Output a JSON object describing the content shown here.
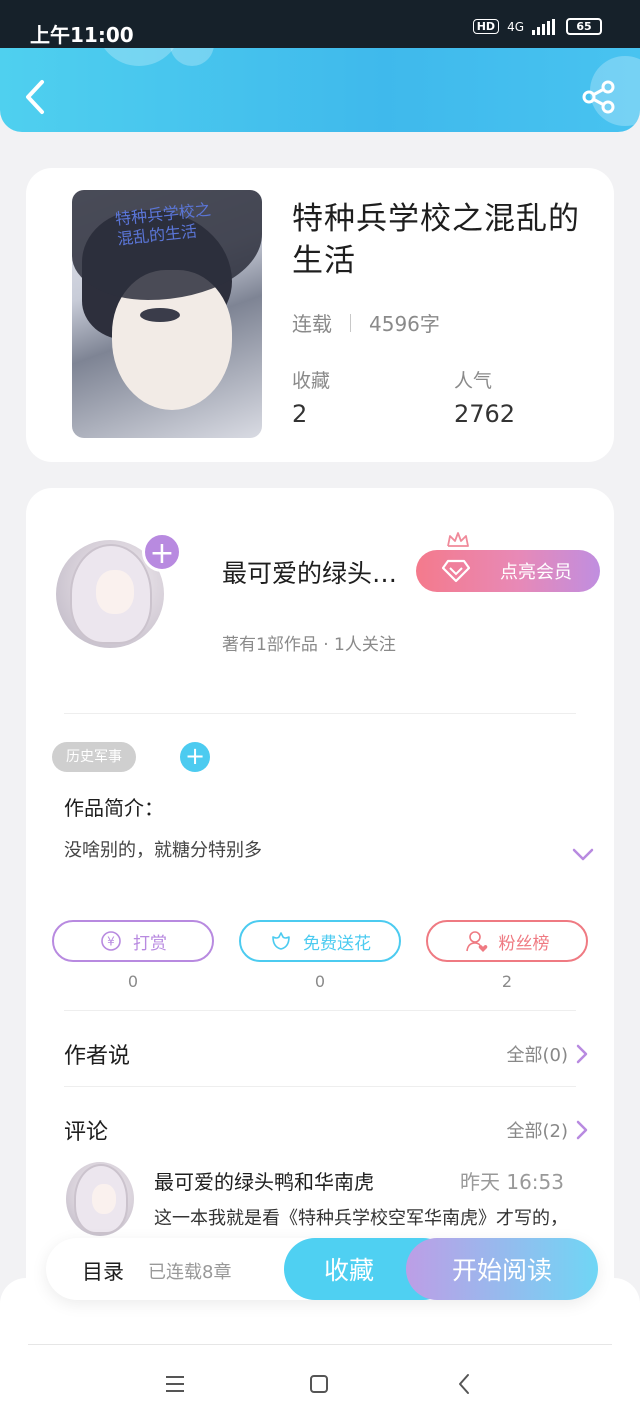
{
  "status_bar": {
    "time": "上午11:00",
    "hd": "HD",
    "network": "4G",
    "battery": "65"
  },
  "book": {
    "cover_text": "特种兵学校之混乱的生活",
    "title": "特种兵学校之混乱的生活",
    "status": "连载",
    "word_count": "4596字",
    "favorites_label": "收藏",
    "favorites_value": "2",
    "popularity_label": "人气",
    "popularity_value": "2762"
  },
  "author": {
    "name": "最可爱的绿头鸭和华南虎",
    "stats": "著有1部作品 · 1人关注",
    "follow_icon": "+",
    "vip_label": "点亮会员"
  },
  "tags": {
    "items": [
      "历史军事"
    ],
    "add_icon": "+"
  },
  "intro": {
    "title": "作品简介：",
    "text": "没啥别的，就糖分特别多"
  },
  "actions": [
    {
      "label": "打赏",
      "count": "0",
      "color": "#b88ae0"
    },
    {
      "label": "免费送花",
      "count": "0",
      "color": "#4ccbf0"
    },
    {
      "label": "粉丝榜",
      "count": "2",
      "color": "#ef7a82"
    }
  ],
  "author_says": {
    "title": "作者说",
    "more": "全部(0)"
  },
  "comments": {
    "title": "评论",
    "more": "全部(2)",
    "items": [
      {
        "name": "最可爱的绿头鸭和华南虎",
        "time": "昨天 16:53",
        "text": "这一本我就是看《特种兵学校空军华南虎》才写的，所以和那本书有点像"
      }
    ]
  },
  "bottom_bar": {
    "toc": "目录",
    "toc_sub": "已连载8章",
    "collect": "收藏",
    "read": "开始阅读"
  },
  "colors": {
    "header": "#3fb9ec",
    "accent_purple": "#b88ae0",
    "accent_blue": "#4ccbf0",
    "accent_red": "#ef7a82"
  },
  "icons": [
    "back-icon",
    "share-icon",
    "plus-icon",
    "diamond-icon",
    "crown-icon",
    "chevron-down-icon",
    "yen-icon",
    "flower-icon",
    "fan-icon",
    "chevron-right-icon",
    "menu-icon",
    "home-icon",
    "nav-back-icon"
  ]
}
